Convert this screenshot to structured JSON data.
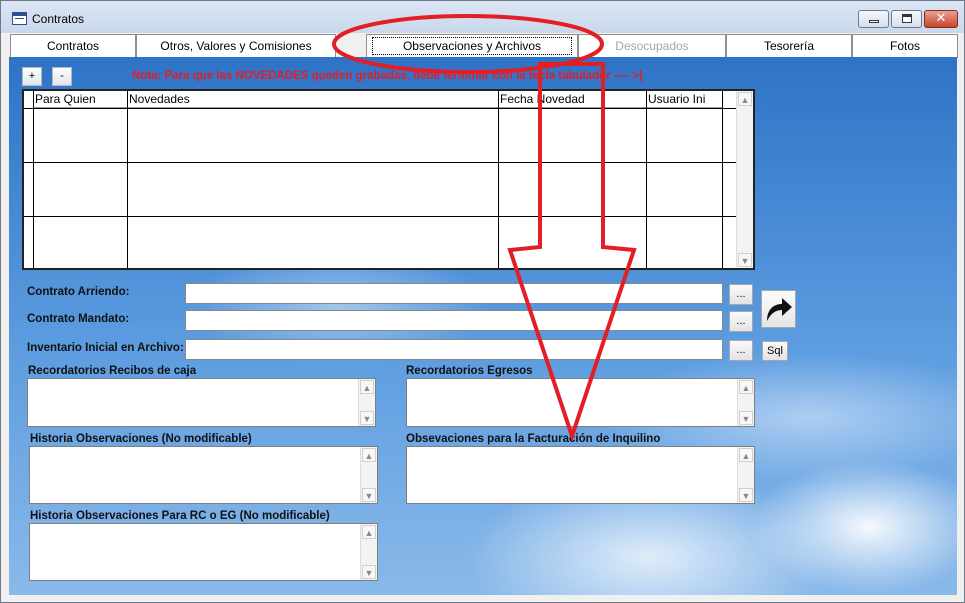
{
  "window": {
    "title": "Contratos",
    "close_glyph": "✕"
  },
  "tabs": [
    {
      "label": "Contratos"
    },
    {
      "label": "Otros, Valores y Comisiones"
    },
    {
      "label": "Observaciones y Archivos"
    },
    {
      "label": "Desocupados"
    },
    {
      "label": "Tesorería"
    },
    {
      "label": "Fotos"
    }
  ],
  "toolbar": {
    "add_label": "+",
    "remove_label": "-"
  },
  "note": "Nota: Para que las NOVEDADES queden grabadas, debe terminar con la tecla tabulador ---- >|",
  "grid": {
    "columns": [
      "Para Quien",
      "Novedades",
      "Fecha Novedad",
      "Usuario Ini"
    ]
  },
  "fields": {
    "contrato_arriendo": {
      "label": "Contrato Arriendo:",
      "value": ""
    },
    "contrato_mandato": {
      "label": "Contrato Mandato:",
      "value": ""
    },
    "inventario": {
      "label": "Inventario Inicial en Archivo:",
      "value": ""
    },
    "browse_label": "...",
    "sql_label": "Sql"
  },
  "memos": {
    "recordatorios_recibos": "Recordatorios Recibos de caja",
    "recordatorios_egresos": "Recordatorios Egresos",
    "historia_obs": "Historia Observaciones (No modificable)",
    "obs_facturacion": "Obsevaciones para la Facturación de Inquilino",
    "historia_obs_rc": "Historia Observaciones Para RC o EG (No modificable)"
  },
  "icons": {
    "scroll_up": "▲",
    "scroll_down": "▼"
  },
  "colors": {
    "annotation_red": "#e31e24",
    "note_red": "#e31e24"
  }
}
